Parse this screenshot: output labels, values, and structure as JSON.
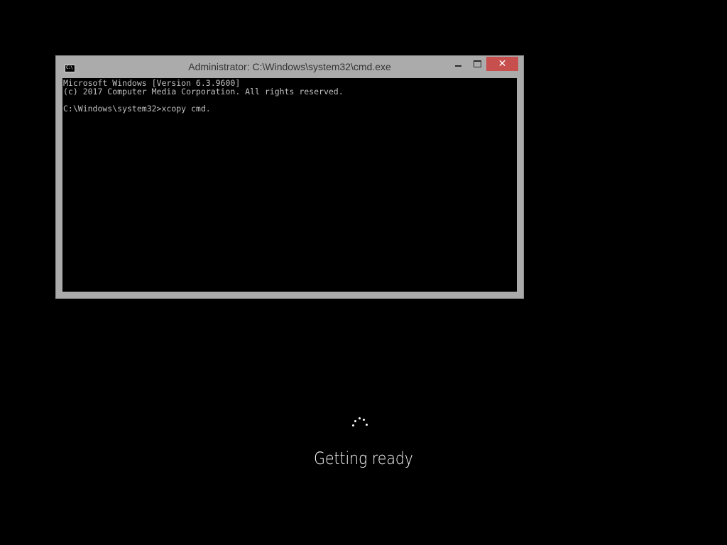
{
  "window": {
    "title": "Administrator: C:\\Windows\\system32\\cmd.exe",
    "icon_label": "C:\\",
    "close_glyph": "✕"
  },
  "console": {
    "lines": [
      "Microsoft Windows [Version 6.3.9600]",
      "(c) 2017 Computer Media Corporation. All rights reserved.",
      "C:\\Windows\\system32>xcopy cmd."
    ]
  },
  "setup": {
    "status": "Getting ready"
  },
  "colors": {
    "desktop_bg": "#000000",
    "window_frame": "#ababab",
    "close_button": "#c7504e",
    "console_text": "#c0c0c0"
  }
}
